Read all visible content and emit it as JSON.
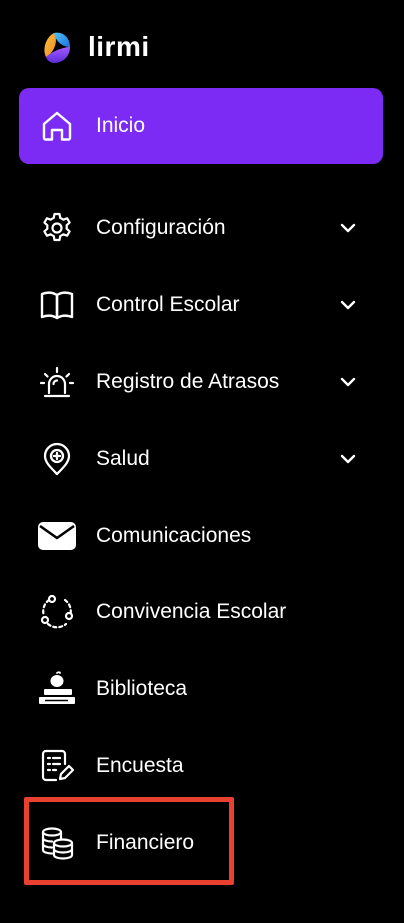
{
  "brand": {
    "name": "lirmi"
  },
  "colors": {
    "active_bg": "#7c2bf5",
    "highlight_border": "#e8412f",
    "background": "#000000",
    "text": "#ffffff"
  },
  "nav": {
    "items": [
      {
        "label": "Inicio",
        "icon": "home-icon",
        "active": true,
        "expandable": false
      },
      {
        "label": "Configuración",
        "icon": "gear-icon",
        "active": false,
        "expandable": true
      },
      {
        "label": "Control Escolar",
        "icon": "book-icon",
        "active": false,
        "expandable": true
      },
      {
        "label": "Registro de Atrasos",
        "icon": "alarm-light-icon",
        "active": false,
        "expandable": true
      },
      {
        "label": "Salud",
        "icon": "health-pin-icon",
        "active": false,
        "expandable": true
      },
      {
        "label": "Comunicaciones",
        "icon": "envelope-icon",
        "active": false,
        "expandable": false
      },
      {
        "label": "Convivencia Escolar",
        "icon": "network-circle-icon",
        "active": false,
        "expandable": false
      },
      {
        "label": "Biblioteca",
        "icon": "books-apple-icon",
        "active": false,
        "expandable": false
      },
      {
        "label": "Encuesta",
        "icon": "survey-icon",
        "active": false,
        "expandable": false
      },
      {
        "label": "Financiero",
        "icon": "coins-stack-icon",
        "active": false,
        "expandable": false,
        "highlighted": true
      }
    ]
  }
}
